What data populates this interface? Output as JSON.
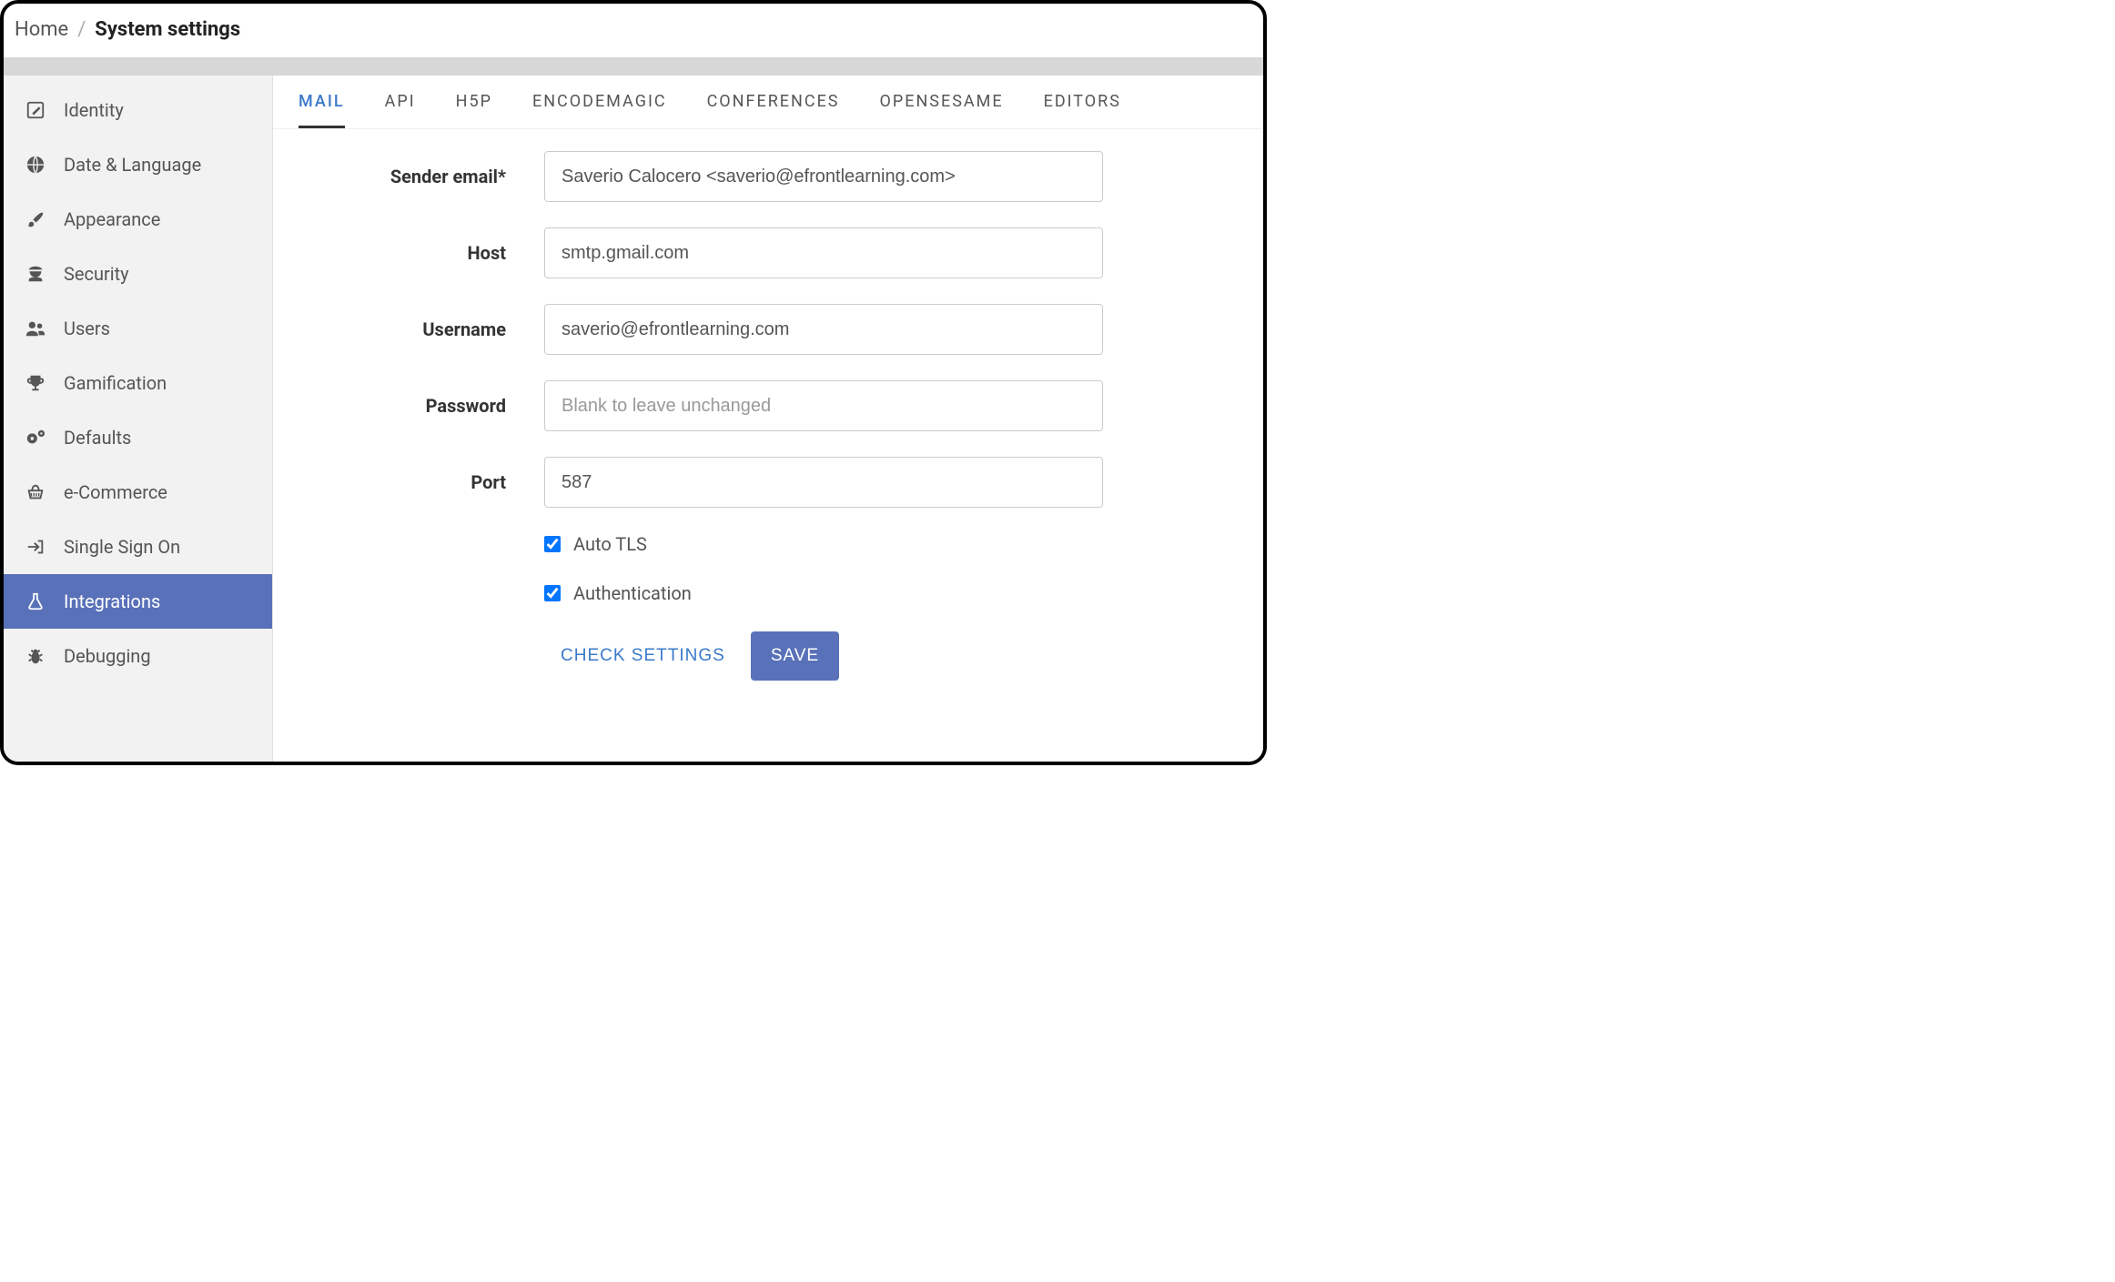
{
  "breadcrumb": {
    "home": "Home",
    "sep": "/",
    "title": "System settings"
  },
  "sidebar": {
    "items": [
      {
        "label": "Identity",
        "icon": "edit-square-icon"
      },
      {
        "label": "Date & Language",
        "icon": "globe-icon"
      },
      {
        "label": "Appearance",
        "icon": "paintbrush-icon"
      },
      {
        "label": "Security",
        "icon": "agent-icon"
      },
      {
        "label": "Users",
        "icon": "users-icon"
      },
      {
        "label": "Gamification",
        "icon": "trophy-icon"
      },
      {
        "label": "Defaults",
        "icon": "gears-icon"
      },
      {
        "label": "e-Commerce",
        "icon": "basket-icon"
      },
      {
        "label": "Single Sign On",
        "icon": "signin-icon"
      },
      {
        "label": "Integrations",
        "icon": "flask-icon",
        "active": true
      },
      {
        "label": "Debugging",
        "icon": "bug-icon"
      }
    ]
  },
  "tabs": [
    {
      "label": "MAIL",
      "active": true
    },
    {
      "label": "API"
    },
    {
      "label": "H5P"
    },
    {
      "label": "ENCODEMAGIC"
    },
    {
      "label": "CONFERENCES"
    },
    {
      "label": "OPENSESAME"
    },
    {
      "label": "EDITORS"
    }
  ],
  "form": {
    "sender_email": {
      "label": "Sender email*",
      "value": "Saverio Calocero <saverio@efrontlearning.com>"
    },
    "host": {
      "label": "Host",
      "value": "smtp.gmail.com"
    },
    "username": {
      "label": "Username",
      "value": "saverio@efrontlearning.com"
    },
    "password": {
      "label": "Password",
      "value": "",
      "placeholder": "Blank to leave unchanged"
    },
    "port": {
      "label": "Port",
      "value": "587"
    },
    "auto_tls": {
      "label": "Auto TLS",
      "checked": true
    },
    "authentication": {
      "label": "Authentication",
      "checked": true
    }
  },
  "buttons": {
    "check": "CHECK SETTINGS",
    "save": "SAVE"
  }
}
